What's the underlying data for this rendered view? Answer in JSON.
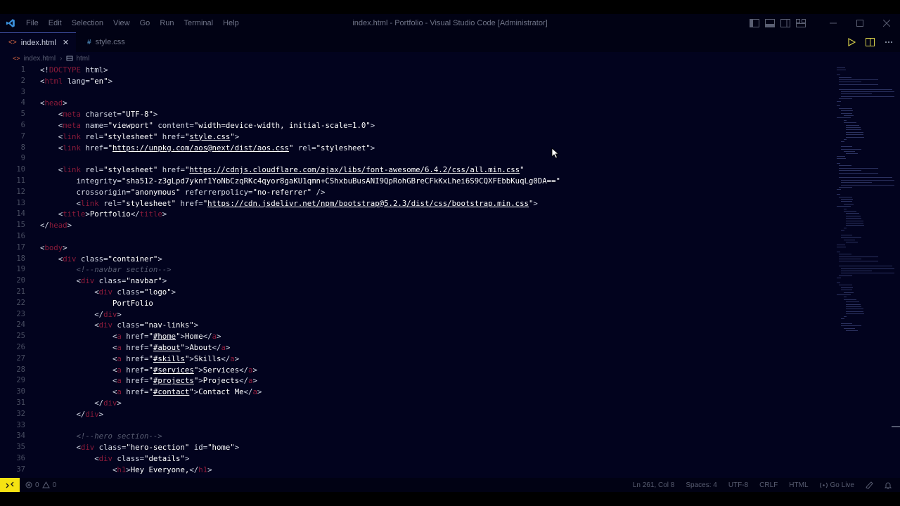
{
  "titlebar": {
    "menu": [
      "File",
      "Edit",
      "Selection",
      "View",
      "Go",
      "Run",
      "Terminal",
      "Help"
    ],
    "window_title": "index.html - Portfolio - Visual Studio Code [Administrator]"
  },
  "tabs": [
    {
      "label": "index.html",
      "icon": "html-file-icon",
      "active": true
    },
    {
      "label": "style.css",
      "icon": "css-file-icon",
      "active": false
    }
  ],
  "tab_icon_glyphs": {
    "html": "<>",
    "css": "#"
  },
  "breadcrumb": {
    "file": "index.html",
    "symbol": "html"
  },
  "code_lines": [
    [
      [
        "p",
        "<!"
      ],
      [
        "d",
        "DOCTYPE"
      ],
      [
        "p",
        " html>"
      ]
    ],
    [
      [
        "p",
        "<"
      ],
      [
        "t",
        "html"
      ],
      [
        "a",
        " lang"
      ],
      [
        "p",
        "="
      ],
      [
        "s",
        "\"en\""
      ],
      [
        "p",
        ">"
      ]
    ],
    [],
    [
      [
        "p",
        "<"
      ],
      [
        "t",
        "head"
      ],
      [
        "p",
        ">"
      ]
    ],
    [
      [
        "x",
        "    "
      ],
      [
        "p",
        "<"
      ],
      [
        "t",
        "meta"
      ],
      [
        "a",
        " charset"
      ],
      [
        "p",
        "="
      ],
      [
        "s",
        "\"UTF-8\""
      ],
      [
        "p",
        ">"
      ]
    ],
    [
      [
        "x",
        "    "
      ],
      [
        "p",
        "<"
      ],
      [
        "t",
        "meta"
      ],
      [
        "a",
        " name"
      ],
      [
        "p",
        "="
      ],
      [
        "s",
        "\"viewport\""
      ],
      [
        "a",
        " content"
      ],
      [
        "p",
        "="
      ],
      [
        "s",
        "\"width=device-width, initial-scale=1.0\""
      ],
      [
        "p",
        ">"
      ]
    ],
    [
      [
        "x",
        "    "
      ],
      [
        "p",
        "<"
      ],
      [
        "t",
        "link"
      ],
      [
        "a",
        " rel"
      ],
      [
        "p",
        "="
      ],
      [
        "s",
        "\"stylesheet\""
      ],
      [
        "a",
        " href"
      ],
      [
        "p",
        "="
      ],
      [
        "s",
        "\""
      ],
      [
        "l",
        "style.css"
      ],
      [
        "s",
        "\""
      ],
      [
        "p",
        ">"
      ]
    ],
    [
      [
        "x",
        "    "
      ],
      [
        "p",
        "<"
      ],
      [
        "t",
        "link"
      ],
      [
        "a",
        " href"
      ],
      [
        "p",
        "="
      ],
      [
        "s",
        "\""
      ],
      [
        "l",
        "https://unpkg.com/aos@next/dist/aos.css"
      ],
      [
        "s",
        "\""
      ],
      [
        "a",
        " rel"
      ],
      [
        "p",
        "="
      ],
      [
        "s",
        "\"stylesheet\""
      ],
      [
        "p",
        ">"
      ]
    ],
    [],
    [
      [
        "x",
        "    "
      ],
      [
        "p",
        "<"
      ],
      [
        "t",
        "link"
      ],
      [
        "a",
        " rel"
      ],
      [
        "p",
        "="
      ],
      [
        "s",
        "\"stylesheet\""
      ],
      [
        "a",
        " href"
      ],
      [
        "p",
        "="
      ],
      [
        "s",
        "\""
      ],
      [
        "l",
        "https://cdnjs.cloudflare.com/ajax/libs/font-awesome/6.4.2/css/all.min.css"
      ],
      [
        "s",
        "\""
      ]
    ],
    [
      [
        "x",
        "        "
      ],
      [
        "a",
        "integrity"
      ],
      [
        "p",
        "="
      ],
      [
        "s",
        "\"sha512-z3gLpd7yknf1YoNbCzqRKc4qyor8gaKU1qmn+CShxbuBusANI9QpRohGBreCFkKxLhei6S9CQXFEbbKuqLg0DA==\""
      ]
    ],
    [
      [
        "x",
        "        "
      ],
      [
        "a",
        "crossorigin"
      ],
      [
        "p",
        "="
      ],
      [
        "s",
        "\"anonymous\""
      ],
      [
        "a",
        " referrerpolicy"
      ],
      [
        "p",
        "="
      ],
      [
        "s",
        "\"no-referrer\""
      ],
      [
        "p",
        " />"
      ]
    ],
    [
      [
        "x",
        "        "
      ],
      [
        "p",
        "<"
      ],
      [
        "t",
        "link"
      ],
      [
        "a",
        " rel"
      ],
      [
        "p",
        "="
      ],
      [
        "s",
        "\"stylesheet\""
      ],
      [
        "a",
        " href"
      ],
      [
        "p",
        "="
      ],
      [
        "s",
        "\""
      ],
      [
        "l",
        "https://cdn.jsdelivr.net/npm/bootstrap@5.2.3/dist/css/bootstrap.min.css"
      ],
      [
        "s",
        "\""
      ],
      [
        "p",
        ">"
      ]
    ],
    [
      [
        "x",
        "    "
      ],
      [
        "p",
        "<"
      ],
      [
        "t",
        "title"
      ],
      [
        "p",
        ">"
      ],
      [
        "x",
        "Portfolio"
      ],
      [
        "p",
        "</"
      ],
      [
        "t",
        "title"
      ],
      [
        "p",
        ">"
      ]
    ],
    [
      [
        "p",
        "</"
      ],
      [
        "t",
        "head"
      ],
      [
        "p",
        ">"
      ]
    ],
    [],
    [
      [
        "p",
        "<"
      ],
      [
        "t",
        "body"
      ],
      [
        "p",
        ">"
      ]
    ],
    [
      [
        "x",
        "    "
      ],
      [
        "p",
        "<"
      ],
      [
        "t",
        "div"
      ],
      [
        "a",
        " class"
      ],
      [
        "p",
        "="
      ],
      [
        "s",
        "\"container\""
      ],
      [
        "p",
        ">"
      ]
    ],
    [
      [
        "x",
        "        "
      ],
      [
        "c",
        "<!--navbar section-->"
      ]
    ],
    [
      [
        "x",
        "        "
      ],
      [
        "p",
        "<"
      ],
      [
        "t",
        "div"
      ],
      [
        "a",
        " class"
      ],
      [
        "p",
        "="
      ],
      [
        "s",
        "\"navbar\""
      ],
      [
        "p",
        ">"
      ]
    ],
    [
      [
        "x",
        "            "
      ],
      [
        "p",
        "<"
      ],
      [
        "t",
        "div"
      ],
      [
        "a",
        " class"
      ],
      [
        "p",
        "="
      ],
      [
        "s",
        "\"logo\""
      ],
      [
        "p",
        ">"
      ]
    ],
    [
      [
        "x",
        "                PortFolio"
      ]
    ],
    [
      [
        "x",
        "            "
      ],
      [
        "p",
        "</"
      ],
      [
        "t",
        "div"
      ],
      [
        "p",
        ">"
      ]
    ],
    [
      [
        "x",
        "            "
      ],
      [
        "p",
        "<"
      ],
      [
        "t",
        "div"
      ],
      [
        "a",
        " class"
      ],
      [
        "p",
        "="
      ],
      [
        "s",
        "\"nav-links\""
      ],
      [
        "p",
        ">"
      ]
    ],
    [
      [
        "x",
        "                "
      ],
      [
        "p",
        "<"
      ],
      [
        "t",
        "a"
      ],
      [
        "a",
        " href"
      ],
      [
        "p",
        "="
      ],
      [
        "s",
        "\""
      ],
      [
        "l",
        "#home"
      ],
      [
        "s",
        "\""
      ],
      [
        "p",
        ">"
      ],
      [
        "x",
        "Home"
      ],
      [
        "p",
        "</"
      ],
      [
        "t",
        "a"
      ],
      [
        "p",
        ">"
      ]
    ],
    [
      [
        "x",
        "                "
      ],
      [
        "p",
        "<"
      ],
      [
        "t",
        "a"
      ],
      [
        "a",
        " href"
      ],
      [
        "p",
        "="
      ],
      [
        "s",
        "\""
      ],
      [
        "l",
        "#about"
      ],
      [
        "s",
        "\""
      ],
      [
        "p",
        ">"
      ],
      [
        "x",
        "About"
      ],
      [
        "p",
        "</"
      ],
      [
        "t",
        "a"
      ],
      [
        "p",
        ">"
      ]
    ],
    [
      [
        "x",
        "                "
      ],
      [
        "p",
        "<"
      ],
      [
        "t",
        "a"
      ],
      [
        "a",
        " href"
      ],
      [
        "p",
        "="
      ],
      [
        "s",
        "\""
      ],
      [
        "l",
        "#skills"
      ],
      [
        "s",
        "\""
      ],
      [
        "p",
        ">"
      ],
      [
        "x",
        "Skills"
      ],
      [
        "p",
        "</"
      ],
      [
        "t",
        "a"
      ],
      [
        "p",
        ">"
      ]
    ],
    [
      [
        "x",
        "                "
      ],
      [
        "p",
        "<"
      ],
      [
        "t",
        "a"
      ],
      [
        "a",
        " href"
      ],
      [
        "p",
        "="
      ],
      [
        "s",
        "\""
      ],
      [
        "l",
        "#services"
      ],
      [
        "s",
        "\""
      ],
      [
        "p",
        ">"
      ],
      [
        "x",
        "Services"
      ],
      [
        "p",
        "</"
      ],
      [
        "t",
        "a"
      ],
      [
        "p",
        ">"
      ]
    ],
    [
      [
        "x",
        "                "
      ],
      [
        "p",
        "<"
      ],
      [
        "t",
        "a"
      ],
      [
        "a",
        " href"
      ],
      [
        "p",
        "="
      ],
      [
        "s",
        "\""
      ],
      [
        "l",
        "#projects"
      ],
      [
        "s",
        "\""
      ],
      [
        "p",
        ">"
      ],
      [
        "x",
        "Projects"
      ],
      [
        "p",
        "</"
      ],
      [
        "t",
        "a"
      ],
      [
        "p",
        ">"
      ]
    ],
    [
      [
        "x",
        "                "
      ],
      [
        "p",
        "<"
      ],
      [
        "t",
        "a"
      ],
      [
        "a",
        " href"
      ],
      [
        "p",
        "="
      ],
      [
        "s",
        "\""
      ],
      [
        "l",
        "#contact"
      ],
      [
        "s",
        "\""
      ],
      [
        "p",
        ">"
      ],
      [
        "x",
        "Contact Me"
      ],
      [
        "p",
        "</"
      ],
      [
        "t",
        "a"
      ],
      [
        "p",
        ">"
      ]
    ],
    [
      [
        "x",
        "            "
      ],
      [
        "p",
        "</"
      ],
      [
        "t",
        "div"
      ],
      [
        "p",
        ">"
      ]
    ],
    [
      [
        "x",
        "        "
      ],
      [
        "p",
        "</"
      ],
      [
        "t",
        "div"
      ],
      [
        "p",
        ">"
      ]
    ],
    [],
    [
      [
        "x",
        "        "
      ],
      [
        "c",
        "<!--hero section-->"
      ]
    ],
    [
      [
        "x",
        "        "
      ],
      [
        "p",
        "<"
      ],
      [
        "t",
        "div"
      ],
      [
        "a",
        " class"
      ],
      [
        "p",
        "="
      ],
      [
        "s",
        "\"hero-section\""
      ],
      [
        "a",
        " id"
      ],
      [
        "p",
        "="
      ],
      [
        "s",
        "\"home\""
      ],
      [
        "p",
        ">"
      ]
    ],
    [
      [
        "x",
        "            "
      ],
      [
        "p",
        "<"
      ],
      [
        "t",
        "div"
      ],
      [
        "a",
        " class"
      ],
      [
        "p",
        "="
      ],
      [
        "s",
        "\"details\""
      ],
      [
        "p",
        ">"
      ]
    ],
    [
      [
        "x",
        "                "
      ],
      [
        "p",
        "<"
      ],
      [
        "t",
        "h1"
      ],
      [
        "p",
        ">"
      ],
      [
        "x",
        "Hey Everyone,"
      ],
      [
        "p",
        "</"
      ],
      [
        "t",
        "h1"
      ],
      [
        "p",
        ">"
      ]
    ]
  ],
  "status": {
    "errors": "0",
    "warnings": "0",
    "position": "Ln 261, Col 8",
    "spaces": "Spaces: 4",
    "encoding": "UTF-8",
    "eol": "CRLF",
    "language": "HTML",
    "go_live": "Go Live"
  },
  "colors": {
    "accent": "#f5e312",
    "tag": "#8b1b3a",
    "editor_bg": "#02031e"
  }
}
